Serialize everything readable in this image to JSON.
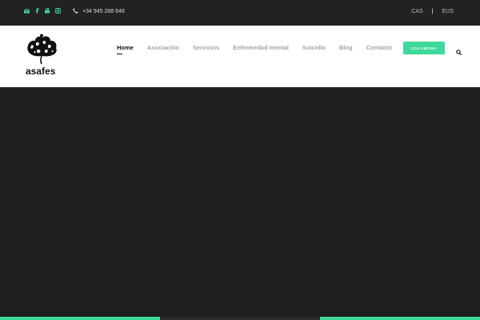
{
  "colors": {
    "accent": "#3fd89b",
    "topbar_bg": "#222222",
    "hero_bg": "#1f1f1f",
    "header_bg": "#ffffff"
  },
  "topbar": {
    "social_icons": [
      "envelope-icon",
      "facebook-icon",
      "youtube-icon",
      "instagram-icon"
    ],
    "phone": "+34 945 288 648",
    "languages": [
      "CAS",
      "EUS"
    ],
    "lang_separator": "|"
  },
  "header": {
    "logo_text": "asafes",
    "nav": [
      {
        "label": "Home",
        "active": true
      },
      {
        "label": "Asociación"
      },
      {
        "label": "Servicios"
      },
      {
        "label": "Enfermedad mental"
      },
      {
        "label": "Suicidio"
      },
      {
        "label": "Blog"
      },
      {
        "label": "Contacto"
      }
    ],
    "cta_label": "COLABORA"
  }
}
